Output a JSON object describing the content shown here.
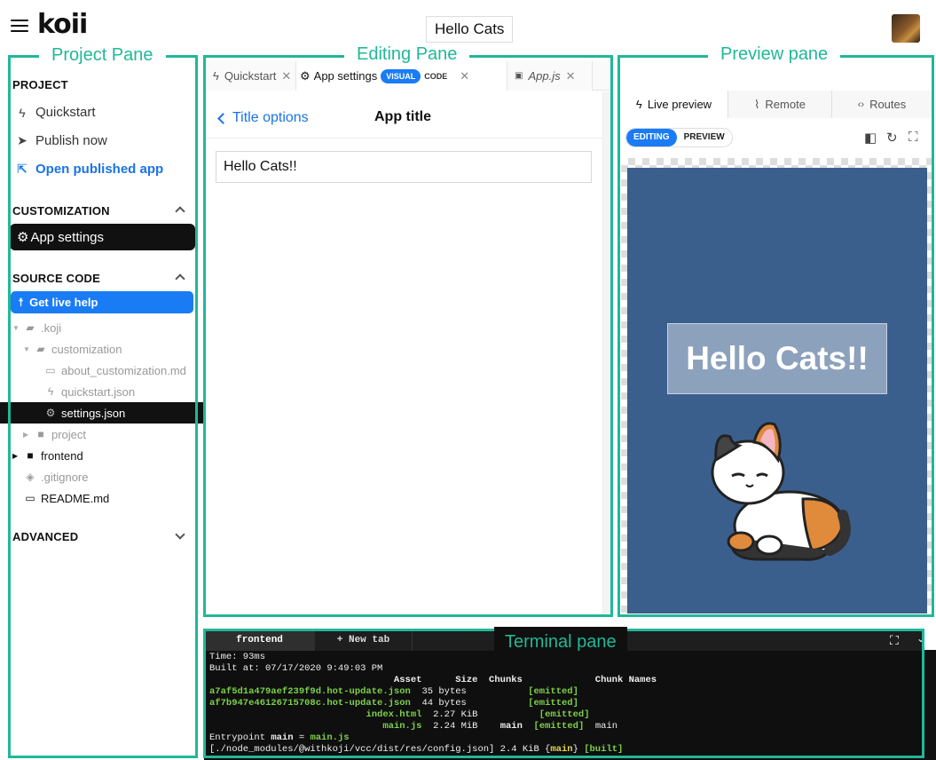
{
  "header": {
    "logo": "koii",
    "app_title": "Hello Cats",
    "icons": {
      "menu": "hamburger-menu-icon",
      "avatar": "user-avatar"
    }
  },
  "annotations": {
    "project_pane": "Project Pane",
    "editing_pane": "Editing Pane",
    "preview_pane": "Preview pane",
    "terminal_pane": "Terminal pane",
    "color": "#20b898"
  },
  "project": {
    "section_title": "PROJECT",
    "items": [
      {
        "label": "Quickstart",
        "icon": "bolt-icon"
      },
      {
        "label": "Publish now",
        "icon": "send-icon"
      },
      {
        "label": "Open published app",
        "icon": "external-link-icon"
      }
    ]
  },
  "customization": {
    "section_title": "CUSTOMIZATION",
    "items": [
      {
        "label": "App settings",
        "icon": "gear-icon",
        "selected": true
      }
    ]
  },
  "source_code": {
    "section_title": "SOURCE CODE",
    "live_help": "Get live help",
    "tree": [
      {
        "label": ".koji",
        "icon": "folder-open-icon",
        "depth": 0,
        "expanded": true
      },
      {
        "label": "customization",
        "icon": "folder-open-icon",
        "depth": 1,
        "expanded": true
      },
      {
        "label": "about_customization.md",
        "icon": "markdown-icon",
        "depth": 2
      },
      {
        "label": "quickstart.json",
        "icon": "bolt-icon",
        "depth": 2
      },
      {
        "label": "settings.json",
        "icon": "gear-icon",
        "depth": 2,
        "selected": true
      },
      {
        "label": "project",
        "icon": "folder-icon",
        "depth": 1
      },
      {
        "label": "frontend",
        "icon": "folder-icon",
        "depth": 0
      },
      {
        "label": ".gitignore",
        "icon": "git-icon",
        "depth": 0
      },
      {
        "label": "README.md",
        "icon": "markdown-icon",
        "depth": 0
      }
    ]
  },
  "advanced": {
    "section_title": "ADVANCED"
  },
  "editor": {
    "tabs": [
      {
        "label": "Quickstart",
        "icon": "bolt-icon"
      },
      {
        "label": "App settings",
        "icon": "gear-icon",
        "active": true,
        "visual": "VISUAL",
        "code": "CODE"
      },
      {
        "label": "App.js",
        "icon": "js-file-icon"
      }
    ],
    "back_label": "Title options",
    "field_title": "App title",
    "field_value": "Hello Cats!!"
  },
  "preview": {
    "tabs": [
      {
        "label": "Live preview",
        "icon": "bolt-icon",
        "active": true
      },
      {
        "label": "Remote",
        "icon": "rss-icon"
      },
      {
        "label": "Routes",
        "icon": "code-icon"
      }
    ],
    "mode_editing": "EDITING",
    "mode_preview": "PREVIEW",
    "tool_icons": [
      "device-icon",
      "refresh-icon",
      "fullscreen-icon"
    ],
    "app_title": "Hello Cats!!",
    "background_color": "#3b5f8d"
  },
  "terminal": {
    "tabs": [
      {
        "label": "frontend",
        "active": true
      },
      {
        "label": "+ New tab"
      }
    ],
    "time_line": "Time: 93ms",
    "built_line": "Built at: 07/17/2020 9:49:03 PM",
    "header_line": "                                 Asset      Size  Chunks             Chunk Names",
    "rows": [
      {
        "asset": "a7af5d1a479aef239f9d.hot-update.json",
        "size": "35 bytes",
        "chunks": "",
        "status": "[emitted]",
        "names": ""
      },
      {
        "asset": "af7b947e46126715708c.hot-update.json",
        "size": "44 bytes",
        "chunks": "",
        "status": "[emitted]",
        "names": ""
      },
      {
        "asset": "index.html",
        "size": "2.27 KiB",
        "chunks": "",
        "status": "[emitted]",
        "names": ""
      },
      {
        "asset": "main.js",
        "size": "2.24 MiB",
        "chunks": "main",
        "status": "[emitted]",
        "names": "main"
      }
    ],
    "entry_prefix": "Entrypoint ",
    "entry_main": "main",
    "entry_eq": " = ",
    "entry_file": "main.js",
    "module_path": "[./node_modules/@withkoji/vcc/dist/res/config.json] 2.4 KiB {",
    "module_chunk": "main",
    "module_close": "} ",
    "module_status": "[built]"
  }
}
